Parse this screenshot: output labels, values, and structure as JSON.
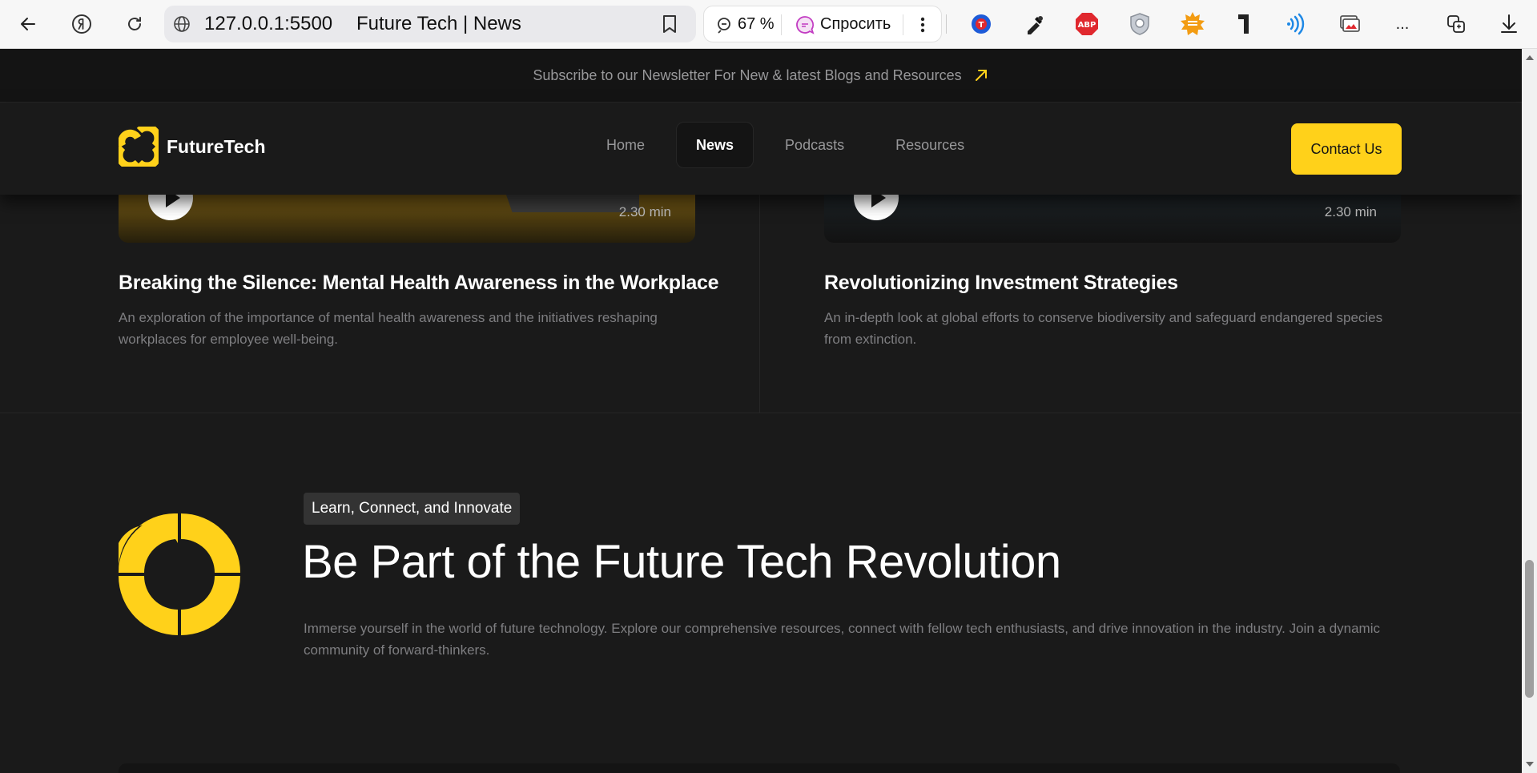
{
  "browser": {
    "url": "127.0.0.1:5500",
    "tab_title": "Future Tech | News",
    "zoom": "67 %",
    "ask_label": "Спросить",
    "more_label": "...",
    "extensions": [
      "translate-extension-icon",
      "color-picker-icon",
      "adblock-icon",
      "shield-extension-icon",
      "sun-extension-icon",
      "typography-extension-icon",
      "wifi-extension-icon",
      "screen-capture-icon"
    ],
    "accent_colors": {
      "abp": "#e0282e",
      "sun": "#f39c12",
      "wifi": "#1e88e5"
    }
  },
  "newsletter": {
    "text": "Subscribe to our Newsletter For New & latest Blogs and Resources"
  },
  "header": {
    "logo_text": "FutureTech",
    "nav": [
      {
        "label": "Home",
        "active": false
      },
      {
        "label": "News",
        "active": true
      },
      {
        "label": "Podcasts",
        "active": false
      },
      {
        "label": "Resources",
        "active": false
      }
    ],
    "contact_label": "Contact Us"
  },
  "cards": [
    {
      "duration": "2.30 min",
      "title": "Breaking the Silence: Mental Health Awareness in the Workplace",
      "description": "An exploration of the importance of mental health awareness and the initiatives reshaping workplaces for employee well-being."
    },
    {
      "duration": "2.30 min",
      "title": "Revolutionizing Investment Strategies",
      "description": "An in-depth look at global efforts to conserve biodiversity and safeguard endangered species from extinction."
    }
  ],
  "cta": {
    "tag": "Learn, Connect, and Innovate",
    "title": "Be Part of the Future Tech Revolution",
    "description": "Immerse yourself in the world of future technology. Explore our comprehensive resources, connect with fellow tech enthusiasts, and drive innovation in the industry. Join a dynamic community of forward-thinkers."
  },
  "colors": {
    "accent": "#ffd11a",
    "background": "#1a1a1a",
    "muted_text": "#7e7e81"
  }
}
